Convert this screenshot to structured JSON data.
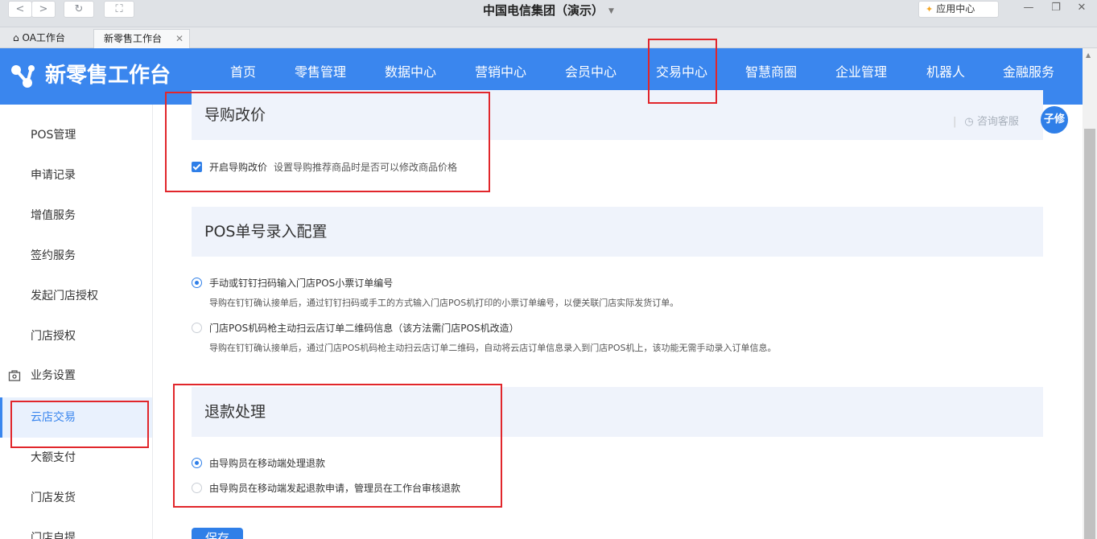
{
  "window": {
    "title": "中国电信集团（演示）",
    "app_center_label": "应用中心",
    "back_glyph": "<",
    "forward_glyph": ">",
    "refresh_glyph": "↻",
    "fullscreen_glyph": "⛶",
    "minimize_glyph": "—",
    "restore_glyph": "❐",
    "close_glyph": "✕"
  },
  "tabs": [
    {
      "label": "OA工作台",
      "icon": "home-icon"
    },
    {
      "label": "新零售工作台",
      "close": "✕"
    }
  ],
  "header": {
    "logo_text": "新零售工作台",
    "accent_color": "#3a86ee",
    "nav": [
      {
        "label": "首页"
      },
      {
        "label": "零售管理"
      },
      {
        "label": "数据中心"
      },
      {
        "label": "营销中心"
      },
      {
        "label": "会员中心"
      },
      {
        "label": "交易中心",
        "active": true
      },
      {
        "label": "智慧商圈"
      },
      {
        "label": "企业管理"
      },
      {
        "label": "机器人"
      },
      {
        "label": "金融服务"
      }
    ]
  },
  "sidebar": {
    "items": [
      {
        "label": "POS管理"
      },
      {
        "label": "申请记录"
      },
      {
        "label": "增值服务"
      },
      {
        "label": "签约服务"
      },
      {
        "label": "发起门店授权"
      },
      {
        "label": "门店授权"
      },
      {
        "label": "业务设置",
        "group": true
      },
      {
        "label": "云店交易",
        "active": true
      },
      {
        "label": "大额支付"
      },
      {
        "label": "门店发货"
      },
      {
        "label": "门店自提"
      }
    ]
  },
  "main": {
    "service_label": "咨询客服",
    "avatar_text": "子修",
    "sections": {
      "guide_price": {
        "title": "导购改价",
        "checkbox_label": "开启导购改价",
        "checkbox_hint": "设置导购推荐商品时是否可以修改商品价格",
        "checked": true
      },
      "pos_config": {
        "title": "POS单号录入配置",
        "options": [
          {
            "label": "手动或钉钉扫码输入门店POS小票订单编号",
            "desc": "导购在钉钉确认接单后，通过钉钉扫码或手工的方式输入门店POS机打印的小票订单编号，以便关联门店实际发货订单。",
            "selected": true
          },
          {
            "label": "门店POS机码枪主动扫云店订单二维码信息（该方法需门店POS机改造）",
            "desc": "导购在钉钉确认接单后，通过门店POS机码枪主动扫云店订单二维码，自动将云店订单信息录入到门店POS机上，该功能无需手动录入订单信息。",
            "selected": false
          }
        ]
      },
      "refund": {
        "title": "退款处理",
        "options": [
          {
            "label": "由导购员在移动端处理退款",
            "selected": true
          },
          {
            "label": "由导购员在移动端发起退款申请，管理员在工作台审核退款",
            "selected": false
          }
        ]
      }
    },
    "save_label": "保存"
  }
}
